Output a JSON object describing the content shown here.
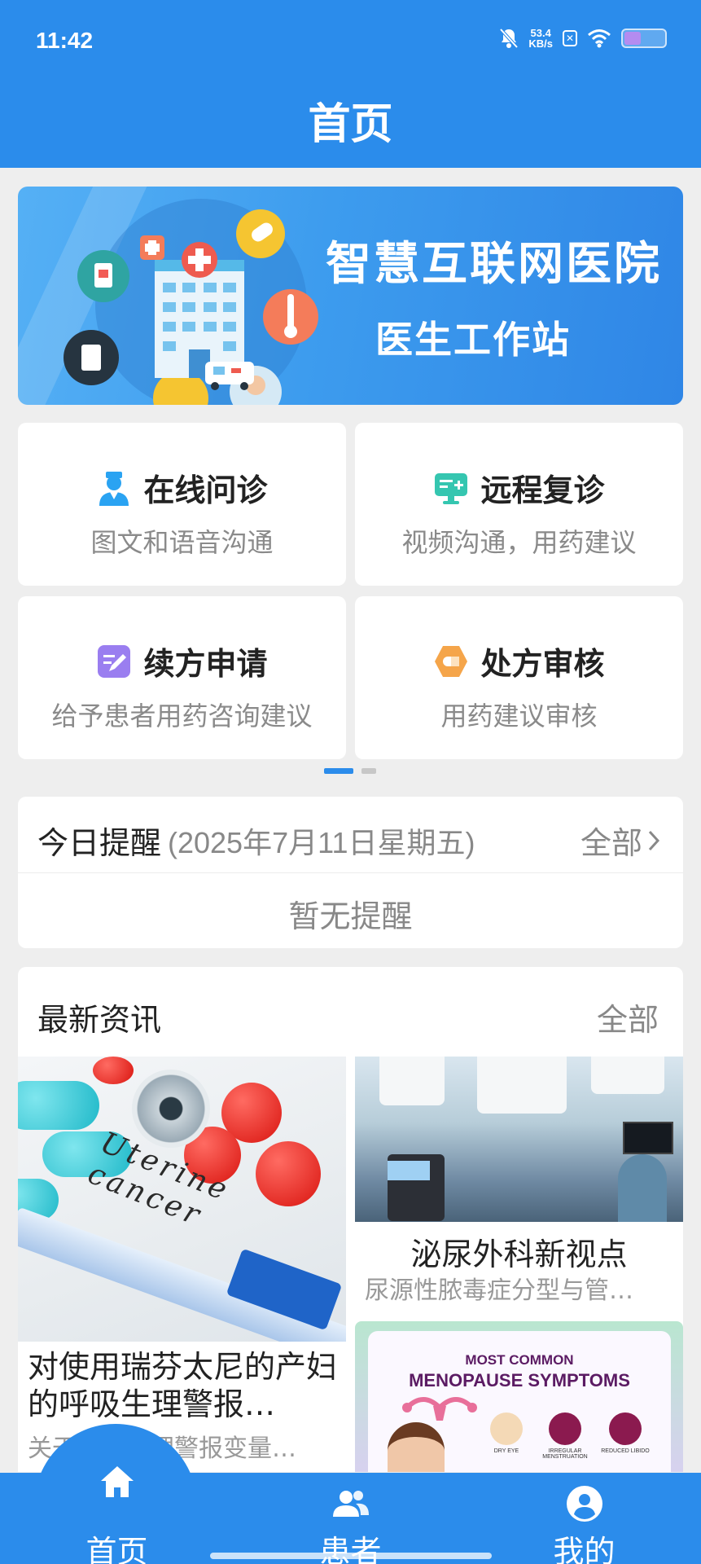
{
  "status_bar": {
    "time": "11:42",
    "net_speed_value": "53.4",
    "net_speed_unit": "KB/s",
    "sim_label": "✕",
    "icons": [
      "mute-bell-icon",
      "sim-x-icon",
      "wifi-icon",
      "battery-icon"
    ]
  },
  "header": {
    "title": "首页"
  },
  "banner": {
    "title": "智慧互联网医院",
    "subtitle": "医生工作站"
  },
  "services": [
    {
      "title": "在线问诊",
      "desc": "图文和语音沟通",
      "icon": "doctor-icon",
      "color": "#2aa3f2"
    },
    {
      "title": "远程复诊",
      "desc": "视频沟通，用药建议",
      "icon": "monitor-plus-icon",
      "color": "#35c6b0"
    },
    {
      "title": "续方申请",
      "desc": "给予患者用药咨询建议",
      "icon": "edit-note-icon",
      "color": "#9a7ef0"
    },
    {
      "title": "处方审核",
      "desc": "用药建议审核",
      "icon": "pill-hexagon-icon",
      "color": "#f5a54a"
    }
  ],
  "reminder": {
    "label": "今日提醒",
    "date": "(2025年7月11日星期五)",
    "all_label": "全部",
    "empty_text": "暂无提醒"
  },
  "news": {
    "label": "最新资讯",
    "all_label": "全部",
    "items": [
      {
        "title": "对使用瑞芬太尼的产妇的呼吸生理警报…",
        "subtitle": "关于呼吸生理警报变量…",
        "image_text": "Uterine cancer"
      },
      {
        "title": "泌尿外科新视点",
        "subtitle": "尿源性脓毒症分型与管…"
      },
      {
        "image_text_1": "MOST COMMON",
        "image_text_2": "MENOPAUSE SYMPTOMS",
        "image_labels": [
          "DRY EYE",
          "IRREGULAR MENSTRUATION",
          "REDUCED LIBIDO"
        ]
      }
    ]
  },
  "tabbar": {
    "tabs": [
      {
        "label": "首页",
        "icon": "home-icon",
        "active": true
      },
      {
        "label": "患者",
        "icon": "patients-icon",
        "active": false
      },
      {
        "label": "我的",
        "icon": "profile-icon",
        "active": false
      }
    ]
  },
  "colors": {
    "primary": "#2b8ceb",
    "background": "#eeeeee",
    "muted_text": "#888888"
  }
}
